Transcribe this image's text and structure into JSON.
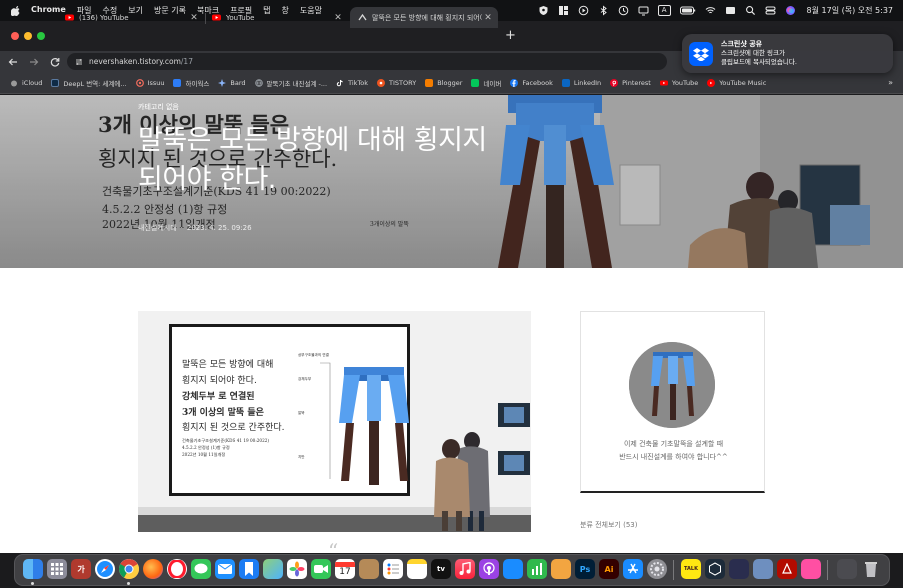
{
  "menubar": {
    "app_name": "Chrome",
    "items": [
      "파일",
      "수정",
      "보기",
      "방문 기록",
      "북마크",
      "프로필",
      "탭",
      "창",
      "도움말"
    ],
    "clock": "8월 17일 (목) 오전 5:37",
    "input_indicator": "A"
  },
  "tabs": [
    {
      "title": "(136) YouTube",
      "active": false
    },
    {
      "title": "YouTube",
      "active": false
    },
    {
      "title": "말뚝은 모든 방향에 대해 횡지지 되어야",
      "active": true
    }
  ],
  "address_bar": {
    "host": "nevershaken.tistory.com",
    "path": "/17"
  },
  "bookmarks": [
    {
      "label": "iCloud",
      "color": "#9a9a9a"
    },
    {
      "label": "DeepL 번역: 세계에...",
      "color": "#0f2b46"
    },
    {
      "label": "Issuu",
      "color": "#f36d5d"
    },
    {
      "label": "하이웍스",
      "color": "#2d7cf6"
    },
    {
      "label": "Bard",
      "color": "#7b61ff"
    },
    {
      "label": "말뚝기초 내진설계 -...",
      "color": "#555555"
    },
    {
      "label": "TikTok",
      "color": "#000000"
    },
    {
      "label": "TISTORY",
      "color": "#eb531f"
    },
    {
      "label": "Blogger",
      "color": "#f57d00"
    },
    {
      "label": "네이버",
      "color": "#03c75a"
    },
    {
      "label": "Facebook",
      "color": "#1877f2"
    },
    {
      "label": "LinkedIn",
      "color": "#0a66c2"
    },
    {
      "label": "Pinterest",
      "color": "#e60023"
    },
    {
      "label": "YouTube",
      "color": "#ff0000"
    },
    {
      "label": "YouTube Music",
      "color": "#ff0000"
    }
  ],
  "bookmarks_more": "»",
  "notification": {
    "title": "스크린샷 공유",
    "line1": "스크린샷에 대한 링크가",
    "line2": "클립보드에 복사되었습니다."
  },
  "post": {
    "category": "카테고리 없음",
    "title_line1": "말뚝은 모든 방향에 대해 횡지지",
    "title_line2": "되어야 한다.",
    "author": "내진설계시대",
    "date": "2023. 4. 25. 09:26"
  },
  "hero_board": {
    "heading1": "3개 이상의 말뚝 들은",
    "heading2": "횡지지 된 것으로 간주한다.",
    "line1": "건축물기초구조설계기준(KDS 41 19 00:2022)",
    "line2": "4.5.2.2 안정성 (1)항 규정",
    "line3": "2022년 10월 11일개정",
    "caption": "3개이상의 말뚝"
  },
  "content_board": {
    "l1": "말뚝은 모든 방향에 대해",
    "l2": "횡지지 되어야 한다.",
    "l3": "강체두부 로 연결된",
    "l4": "3개 이상의 말뚝 들은",
    "l5": "횡지지 된 것으로 간주한다.",
    "s1": "건축물기초구조설계기준(KDS 41 19 00:2022)",
    "s2": "4.5.2.2 안정성 (1)항 규정",
    "s3": "2022년 10월 11일개정",
    "d1": "상부구조물과의 연결",
    "d2": "강체두부",
    "d3": "말뚝",
    "d4": "지반"
  },
  "sidebar": {
    "intro_line1": "이제 건축물 기초말뚝을 설계할 때",
    "intro_line2": "반드시 내진설계를 하여야 합니다^^",
    "category_link": "분류 전체보기 (53)"
  },
  "quote_mark": "“",
  "dock": {
    "calendar_day": "17",
    "tv_label": "tv",
    "ps_label": "Ps",
    "ai_label": "Ai",
    "ka_label": "가",
    "talk_label": "TALK"
  }
}
